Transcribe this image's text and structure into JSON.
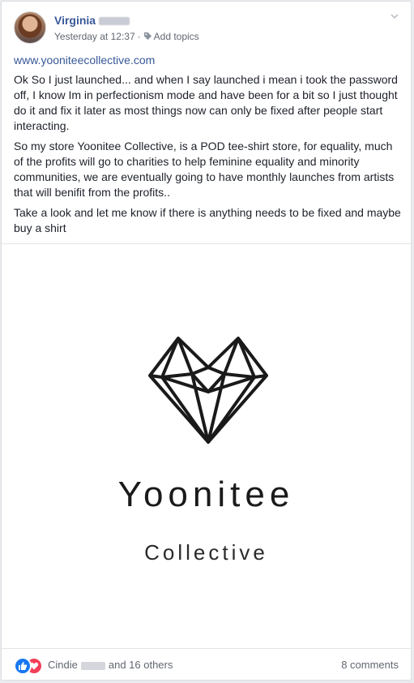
{
  "post": {
    "author_name": "Virginia",
    "timestamp": "Yesterday at 12:37",
    "separator": "·",
    "add_topics_label": "Add topics",
    "link_url": "www.yooniteecollective.com",
    "paragraphs": [
      "Ok So I just launched... and when I say launched i mean i took the password off, I know Im in perfectionism mode and have been for a bit so I just thought do it and fix it later as most things now can only be fixed after people start interacting.",
      "So my store Yoonitee Collective, is a POD tee-shirt store, for equality, much of the profits will go to charities to help feminine equality and minority communities, we are eventually going to have monthly launches from artists that will benifit from the profits..",
      "Take a look and let me know if there is anything needs to be fixed and maybe buy a shirt"
    ],
    "image": {
      "brand_title": "Yoonitee",
      "brand_subtitle": "Collective"
    }
  },
  "footer": {
    "liker_name": "Cindie",
    "others_text": "and 16 others",
    "comments_label": "8 comments"
  },
  "icons": {
    "like": "like-thumb-icon",
    "love": "love-heart-icon",
    "tag": "tag-icon",
    "menu": "chevron-down-icon"
  },
  "colors": {
    "link_blue": "#385898",
    "like_blue": "#1877f2",
    "love_red": "#f33e58"
  }
}
